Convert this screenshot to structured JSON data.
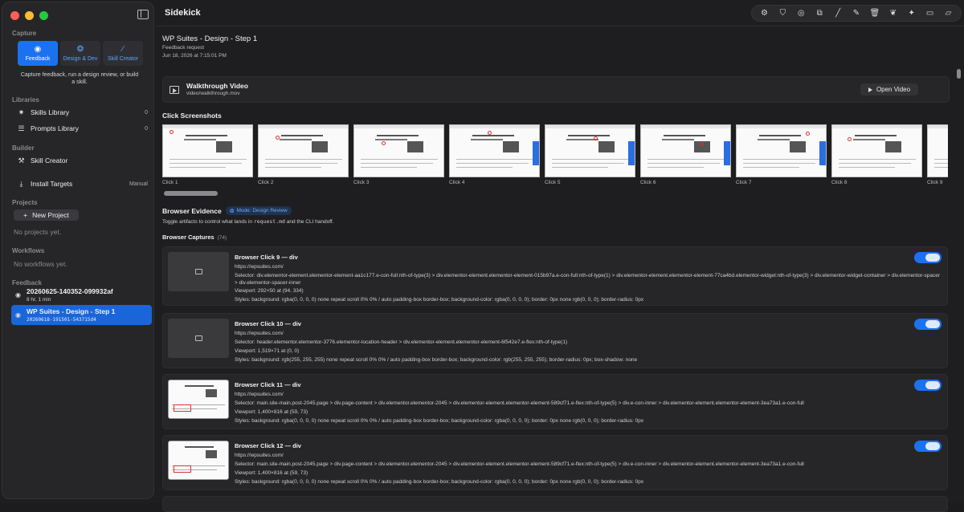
{
  "app": {
    "title": "Sidekick"
  },
  "sidebar": {
    "capture_label": "Capture",
    "capture_buttons": [
      {
        "label": "Feedback",
        "icon": "eye-icon"
      },
      {
        "label": "Design & Dev",
        "icon": "palette-icon"
      },
      {
        "label": "Skill Creator",
        "icon": "wand-icon"
      }
    ],
    "capture_desc": "Capture feedback, run a design review, or build a skill.",
    "libraries_label": "Libraries",
    "skills_library": {
      "label": "Skills Library",
      "count": "0"
    },
    "prompts_library": {
      "label": "Prompts Library",
      "count": "0"
    },
    "builder_label": "Builder",
    "skill_creator": "Skill Creator",
    "install_targets": {
      "label": "Install Targets",
      "mode": "Manual"
    },
    "projects_label": "Projects",
    "new_project": "New Project",
    "no_projects": "No projects yet.",
    "workflows_label": "Workflows",
    "no_workflows": "No workflows yet.",
    "feedback_label": "Feedback",
    "feedback_items": [
      {
        "title": "20260625-140352-099932af",
        "sub": "8 hr, 1 min"
      },
      {
        "title": "WP Suites - Design - Step 1",
        "sub": "20260618-191501-543715d4"
      }
    ]
  },
  "main": {
    "title": "WP Suites - Design - Step 1",
    "type": "Feedback request",
    "date": "Jun 18, 2026 at 7:15:01 PM",
    "video": {
      "title": "Walkthrough Video",
      "path": "video/walkthrough.mov",
      "button": "Open Video"
    },
    "click_screenshots_label": "Click Screenshots",
    "clicks": [
      "Click 1",
      "Click 2",
      "Click 3",
      "Click 4",
      "Click 5",
      "Click 6",
      "Click 7",
      "Click 8",
      "Click 9"
    ],
    "evidence_label": "Browser Evidence",
    "mode_badge": "Mode: Design Review",
    "toggle_desc_pre": "Toggle artifacts to control what lands in ",
    "toggle_desc_file": "request.md",
    "toggle_desc_post": " and the CLI handoff.",
    "captures_label": "Browser Captures",
    "captures_count": "(74)",
    "captures": [
      {
        "title": "Browser Click 9 — div",
        "url": "https://wpsuites.com/",
        "selector": "Selector: div.elementor-element.elementor-element-aa1c177.e-con-full:nth-of-type(3) > div.elementor-element.elementor-element-015b97a.e-con-full:nth-of-type(1) > div.elementor-element.elementor-element-77ca4bd.elementor-widget:nth-of-type(3) > div.elementor-widget-container > div.elementor-spacer > div.elementor-spacer-inner",
        "viewport": "Viewport: 292×50 at (94, 334)",
        "styles": "Styles: background: rgba(0, 0, 0, 0) none repeat scroll 0% 0% / auto padding-box border-box; background-color: rgba(0, 0, 0, 0); border: 0px none rgb(0, 0, 0); border-radius: 0px"
      },
      {
        "title": "Browser Click 10 — div",
        "url": "https://wpsuites.com/",
        "selector": "Selector: header.elementor.elementor-3776.elementor-location-header > div.elementor-element.elementor-element-6f542e7.e-flex:nth-of-type(1)",
        "viewport": "Viewport: 1,519×71 at (0, 0)",
        "styles": "Styles: background: rgb(255, 255, 255) none repeat scroll 0% 0% / auto padding-box border-box; background-color: rgb(255, 255, 255); border-radius: 0px; box-shadow: none"
      },
      {
        "title": "Browser Click 11 — div",
        "url": "https://wpsuites.com/",
        "selector": "Selector: main.site-main.post-2045.page > div.page-content > div.elementor.elementor-2045 > div.elementor-element.elementor-element-589cf71.e-flex:nth-of-type(5) > div.e-con-inner > div.elementor-element.elementor-element-3ea73a1.e-con-full",
        "viewport": "Viewport: 1,400×816 at (59, 73)",
        "styles": "Styles: background: rgba(0, 0, 0, 0) none repeat scroll 0% 0% / auto padding-box border-box; background-color: rgba(0, 0, 0, 0); border: 0px none rgb(0, 0, 0); border-radius: 0px"
      },
      {
        "title": "Browser Click 12 — div",
        "url": "https://wpsuites.com/",
        "selector": "Selector: main.site-main.post-2045.page > div.page-content > div.elementor.elementor-2045 > div.elementor-element.elementor-element-589cf71.e-flex:nth-of-type(5) > div.e-con-inner > div.elementor-element.elementor-element-3ea73a1.e-con-full",
        "viewport": "Viewport: 1,400×816 at (59, 73)",
        "styles": "Styles: background: rgba(0, 0, 0, 0) none repeat scroll 0% 0% / auto padding-box border-box; background-color: rgba(0, 0, 0, 0); border: 0px none rgb(0, 0, 0); border-radius: 0px"
      }
    ]
  },
  "colors": {
    "accent": "#1a72f0",
    "selected": "#1a66d9"
  }
}
